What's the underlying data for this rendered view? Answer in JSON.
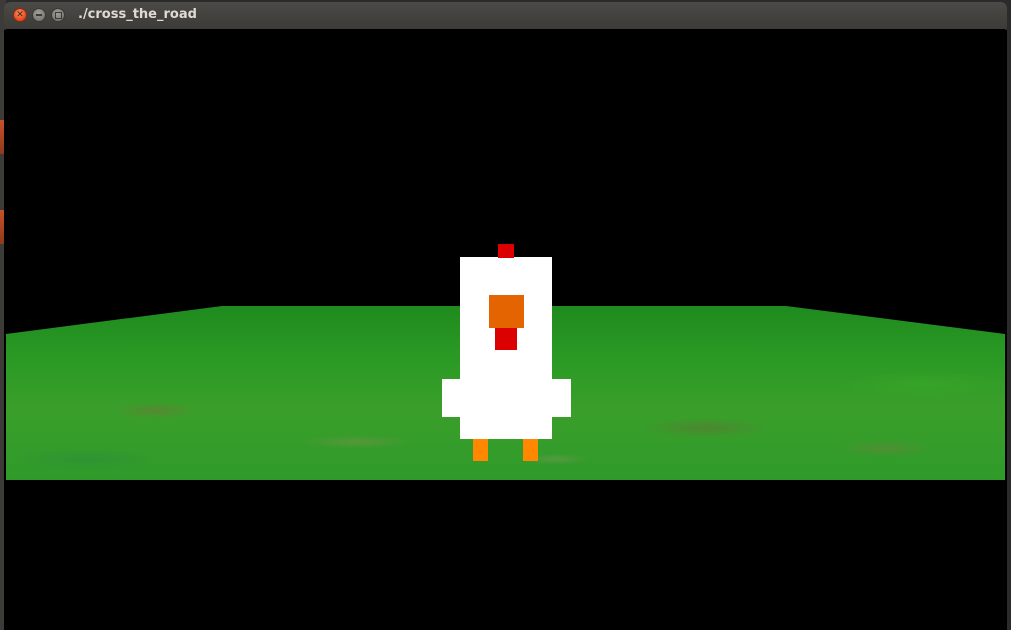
{
  "window": {
    "title": "./cross_the_road",
    "buttons": {
      "close_icon": "close-icon",
      "minimize_icon": "minimize-icon",
      "maximize_icon": "maximize-icon"
    }
  },
  "scene": {
    "background_color": "#000000",
    "ground_color": "#2a9a25",
    "chicken": {
      "body_color": "#ffffff",
      "comb_color": "#dd0000",
      "beak_color": "#e36400",
      "wattle_color": "#dd0000",
      "leg_color": "#ff8800"
    }
  }
}
